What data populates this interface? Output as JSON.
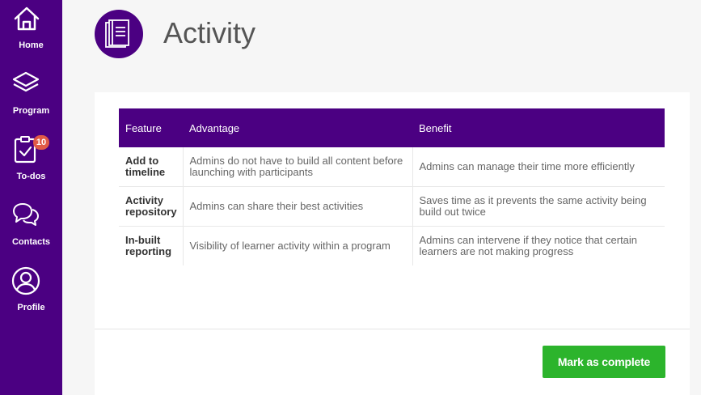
{
  "sidebar": {
    "items": [
      {
        "label": "Home",
        "icon": "home-icon"
      },
      {
        "label": "Program",
        "icon": "layers-icon"
      },
      {
        "label": "To-dos",
        "icon": "clipboard-check-icon",
        "badge": "10"
      },
      {
        "label": "Contacts",
        "icon": "chat-bubbles-icon"
      },
      {
        "label": "Profile",
        "icon": "user-circle-icon"
      }
    ]
  },
  "header": {
    "title": "Activity",
    "icon": "documents-icon"
  },
  "table": {
    "headers": [
      "Feature",
      "Advantage",
      "Benefit"
    ],
    "rows": [
      [
        "Add to timeline",
        "Admins do not have to build all content before launching with participants",
        "Admins can manage their time more efficiently"
      ],
      [
        "Activity repository",
        "Admins can share their best activities",
        "Saves time as it prevents the same activity being build out twice"
      ],
      [
        "In-built reporting",
        "Visibility of learner activity within a program",
        "Admins can intervene if they notice that certain learners are not making progress"
      ]
    ]
  },
  "footer": {
    "mark_complete_label": "Mark as complete"
  },
  "colors": {
    "primary": "#4b0082",
    "success": "#2cb42c",
    "badge": "#e05a46"
  }
}
